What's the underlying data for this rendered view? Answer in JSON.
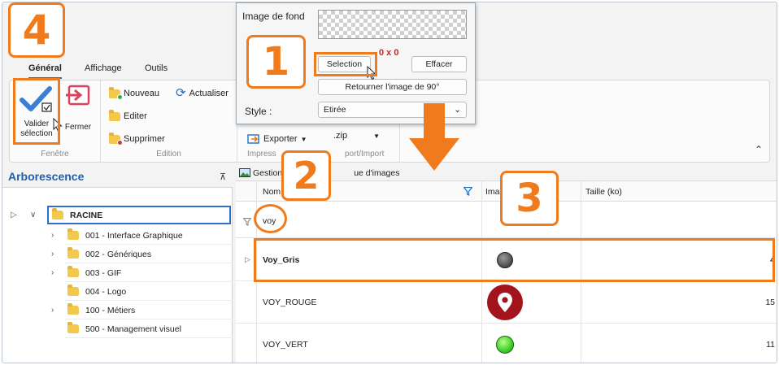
{
  "tabs": [
    "Général",
    "Affichage",
    "Outils"
  ],
  "ribbon": {
    "fenetre": {
      "label": "Fenêtre",
      "validate": "Valider\nsélection",
      "validate_line1": "Valider",
      "validate_line2": "sélection",
      "close": "Fermer"
    },
    "edition": {
      "label": "Edition",
      "new": "Nouveau",
      "refresh": "Actualiser",
      "edit": "Editer",
      "delete": "Supprimer"
    },
    "import": {
      "label_left": "Impress",
      "label_right": "port/Import",
      "export": "Exporter",
      "zip": ".zip"
    }
  },
  "popup": {
    "bg_label": "Image de fond",
    "size_hint": "0 x 0",
    "selection": "Selection",
    "clear": "Effacer",
    "rotate": "Retourner l'image de 90°",
    "style_label": "Style :",
    "style_value": "Etirée"
  },
  "left_panel": {
    "title": "Arborescence",
    "tree": [
      {
        "label": "RACINE",
        "level": 0
      },
      {
        "label": "001 - Interface Graphique",
        "level": 1
      },
      {
        "label": "002 - Génériques",
        "level": 1
      },
      {
        "label": "003 - GIF",
        "level": 1
      },
      {
        "label": "004 - Logo",
        "level": 1
      },
      {
        "label": "100 - Métiers",
        "level": 1
      },
      {
        "label": "500 - Management visuel",
        "level": 1
      }
    ]
  },
  "grid": {
    "title_left": "Gestion",
    "title_right": "ue d'images",
    "columns": {
      "name": "Nom",
      "image": "Imag",
      "size": "Taille (ko)"
    },
    "filter_value": "voy",
    "rows": [
      {
        "name": "Voy_Gris",
        "size": "4"
      },
      {
        "name": "VOY_ROUGE",
        "size": "15"
      },
      {
        "name": "VOY_VERT",
        "size": "11"
      }
    ]
  },
  "annotations": [
    "1",
    "2",
    "3",
    "4"
  ],
  "colors": {
    "accent": "#f07b1c",
    "title_blue": "#1f5fb0",
    "tab_underline": "#1f6fc5"
  }
}
